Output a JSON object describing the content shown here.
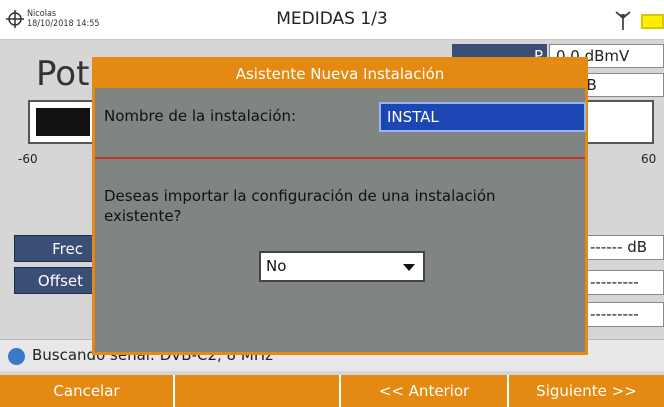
{
  "header": {
    "user": "Nicolas",
    "datetime": "18/10/2018 14:55",
    "title": "MEDIDAS 1/3"
  },
  "measure": {
    "big_label": "Pot",
    "panel_button": "P",
    "value_1": "0.0 dBmV",
    "value_2": "--- dB",
    "axis_min": "-60",
    "axis_max": "60",
    "value_3": "------ dB",
    "value_4": "---------",
    "value_5": "---------"
  },
  "side_buttons": {
    "frec": "Frec",
    "offset": "Offset"
  },
  "search": {
    "text": "Buscando señal: DVB-C2, 8 MHz"
  },
  "dialog": {
    "title": "Asistente Nueva Instalación",
    "name_label": "Nombre de la instalación:",
    "name_value": "INSTAL",
    "question": "Deseas importar la configuración de una instalación existente?",
    "select_value": "No"
  },
  "footer": {
    "cancel": "Cancelar",
    "empty": "",
    "previous": "<< Anterior",
    "next": "Siguiente >>"
  },
  "colors": {
    "accent": "#e48a12",
    "navy": "#3b4e76",
    "input_blue": "#1b46b4",
    "battery": "#ffee00"
  }
}
